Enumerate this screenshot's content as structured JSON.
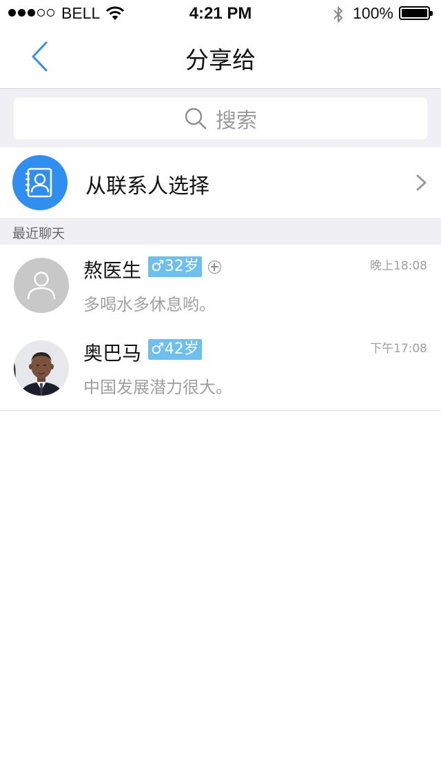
{
  "status_bar": {
    "carrier": "BELL",
    "time": "4:21 PM",
    "battery": "100%",
    "signal_total": 5,
    "signal_filled": 3
  },
  "nav": {
    "title": "分享给"
  },
  "search": {
    "placeholder": "搜索"
  },
  "contacts_row": {
    "label": "从联系人选择"
  },
  "section": {
    "label": "最近聊天"
  },
  "chats": [
    {
      "name": "熬医生",
      "gender_symbol": "♂",
      "age": "32岁",
      "message": "多喝水多休息哟。",
      "time": "晚上18:08"
    },
    {
      "name": "奥巴马",
      "gender_symbol": "♂",
      "age": "42岁",
      "message": "中国发展潜力很大。",
      "time": "下午17:08"
    }
  ],
  "colors": {
    "accent": "#2e8ff0",
    "badge": "#6dbff0",
    "background_gray": "#efeff4"
  }
}
